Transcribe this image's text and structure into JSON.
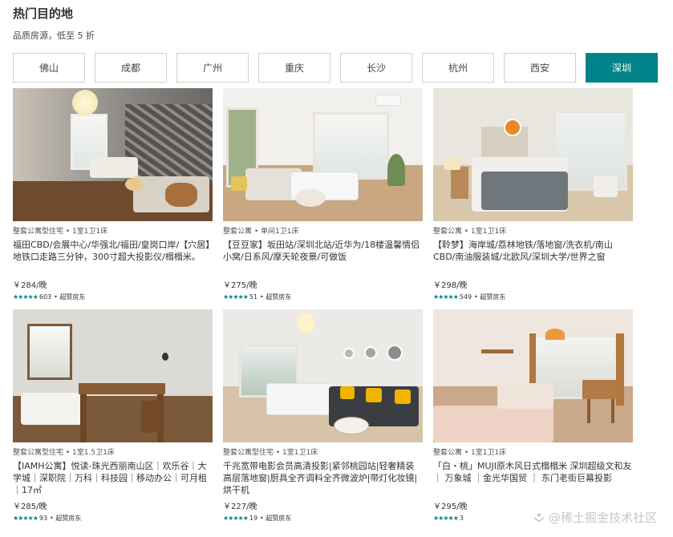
{
  "header": {
    "title": "热门目的地",
    "subtitle": "品质房源，低至 5 折"
  },
  "tabs": [
    {
      "label": "佛山",
      "active": false
    },
    {
      "label": "成都",
      "active": false
    },
    {
      "label": "广州",
      "active": false
    },
    {
      "label": "重庆",
      "active": false
    },
    {
      "label": "长沙",
      "active": false
    },
    {
      "label": "杭州",
      "active": false
    },
    {
      "label": "西安",
      "active": false
    },
    {
      "label": "深圳",
      "active": true
    }
  ],
  "colors": {
    "accent": "#008489",
    "stars": "#008489"
  },
  "listings": [
    {
      "meta": "整套公寓型住宅 • 1室1卫1床",
      "name": "福田CBD/会展中心/华强北/福田/皇岗口岸/【穴居】地铁口走路三分钟，300寸超大投影仪/榻榻米。",
      "price": "￥284/晚",
      "stars": "★★★★★",
      "reviews": "603",
      "badge": "• 超赞房东"
    },
    {
      "meta": "整套公寓 • 单间1卫1床",
      "name": "【豆豆家】坂田站/深圳北站/近华为/18楼温馨情侣小窝/日系风/摩天轮夜景/可做饭",
      "price": "￥275/晚",
      "stars": "★★★★★",
      "reviews": "51",
      "badge": "• 超赞房东"
    },
    {
      "meta": "整套公寓 • 1室1卫1床",
      "name": "【聆梦】海岸城/荔林地铁/落地窗/洗衣机/南山CBD/南油服装城/北欧风/深圳大学/世界之窗",
      "price": "￥298/晚",
      "stars": "★★★★★",
      "reviews": "549",
      "badge": "• 超赞房东"
    },
    {
      "meta": "整套公寓型住宅 • 1室1.5卫1床",
      "name": "【IAMH公寓】悦读-珠光西丽南山区｜欢乐谷｜大学城｜深职院｜万科｜科技园｜移动办公｜可月租｜17㎡",
      "price": "￥285/晚",
      "stars": "★★★★★",
      "reviews": "93",
      "badge": "• 超赞房东"
    },
    {
      "meta": "整套公寓型住宅 • 1室1卫1床",
      "name": "千兆宽带电影会员高清投影|紧邻桃园站|轻奢精装高层落地窗|厨具全齐调料全齐微波炉|带灯化妆镜|烘干机",
      "price": "￥227/晚",
      "stars": "★★★★★",
      "reviews": "19",
      "badge": "• 超赞房东"
    },
    {
      "meta": "整套公寓 • 1室1卫1床",
      "name": "「白・桃」MUJI原木风日式榻榻米 深圳超级文和友 ｜ 万象城 ｜金光华国贸 ｜ 东门老街巨幕投影",
      "price": "￥295/晚",
      "stars": "★★★★★",
      "reviews": "3",
      "badge": ""
    }
  ],
  "watermark": "@稀土掘金技术社区"
}
